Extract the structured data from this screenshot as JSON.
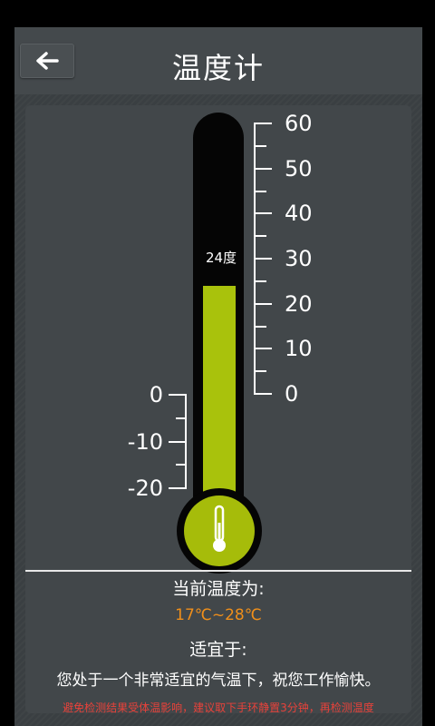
{
  "header": {
    "title": "温度计",
    "back_icon": "arrow-left-icon"
  },
  "thermometer": {
    "current_label": "24度",
    "current_value": 24,
    "scale_right_labels": [
      "60",
      "50",
      "40",
      "30",
      "20",
      "10",
      "0"
    ],
    "scale_left_labels": [
      "0",
      "-10",
      "-20"
    ],
    "mercury_color": "#a9c20c",
    "bulb_icon": "thermometer-icon"
  },
  "info": {
    "range_label": "当前温度为:",
    "range_value": "17℃~28℃",
    "range_color": "#f08f1a",
    "suitable_label": "适宜于:",
    "suitable_text": "您处于一个非常适宜的气温下，祝您工作愉快。",
    "warning": "避免检测结果受体温影响，建议取下手环静置3分钟，再检测温度",
    "warning_color": "#e8423a"
  }
}
